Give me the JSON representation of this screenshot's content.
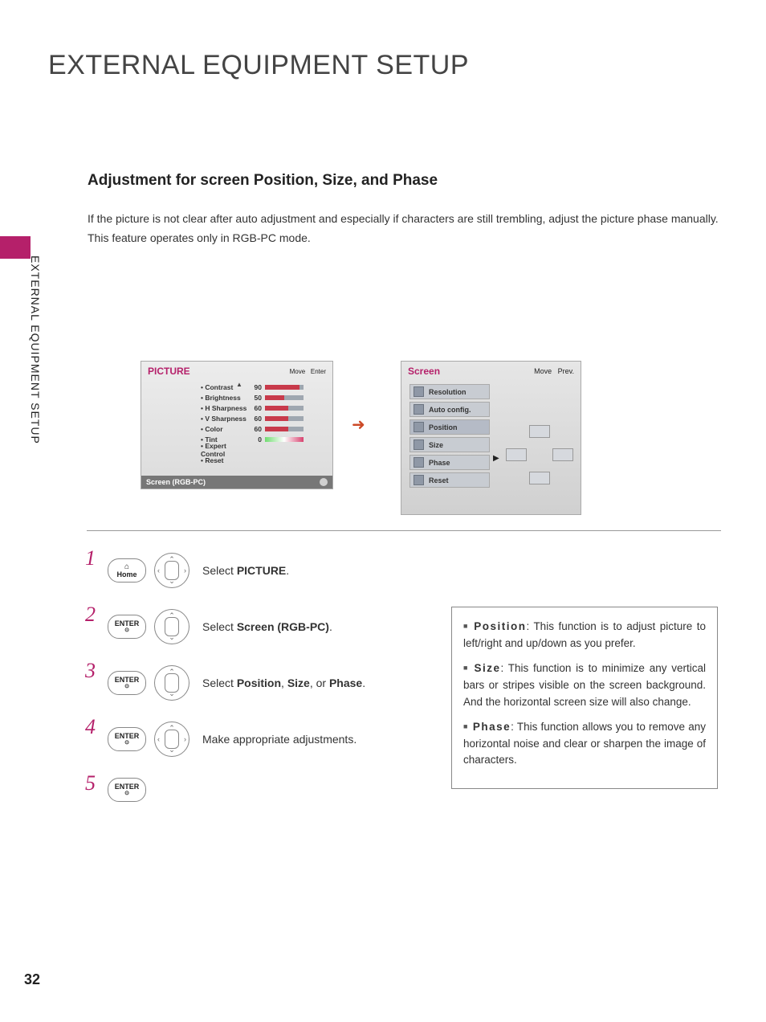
{
  "page_number": "32",
  "side_label": "EXTERNAL EQUIPMENT SETUP",
  "title": "EXTERNAL EQUIPMENT SETUP",
  "subtitle": "Adjustment for screen Position, Size, and Phase",
  "body_p1": "If the picture is not clear after auto adjustment and especially if characters are still trembling, adjust the picture phase manually.",
  "body_p2": "This feature operates only in RGB-PC mode.",
  "picture_menu": {
    "header": "PICTURE",
    "hint_move": "Move",
    "hint_enter": "Enter",
    "rows": [
      {
        "label": "• Contrast",
        "value": "90",
        "fill": 90
      },
      {
        "label": "• Brightness",
        "value": "50",
        "fill": 50
      },
      {
        "label": "• H Sharpness",
        "value": "60",
        "fill": 60
      },
      {
        "label": "• V Sharpness",
        "value": "60",
        "fill": 60
      },
      {
        "label": "• Color",
        "value": "60",
        "fill": 60
      }
    ],
    "tint_label": "• Tint",
    "tint_value": "0",
    "expert": "• Expert Control",
    "reset": "• Reset",
    "selected": "Screen (RGB-PC)"
  },
  "screen_menu": {
    "header": "Screen",
    "hint_move": "Move",
    "hint_prev": "Prev.",
    "options": [
      "Resolution",
      "Auto config.",
      "Position",
      "Size",
      "Phase",
      "Reset"
    ],
    "selected_index": 2
  },
  "steps": [
    {
      "n": "1",
      "btn": "Home",
      "dpad": "full",
      "text_pre": "Select ",
      "text_bold": "PICTURE",
      "text_post": "."
    },
    {
      "n": "2",
      "btn": "ENTER",
      "dpad": "ud",
      "text_pre": "Select ",
      "text_bold": "Screen (RGB-PC)",
      "text_post": "."
    },
    {
      "n": "3",
      "btn": "ENTER",
      "dpad": "ud",
      "text_pre": "Select ",
      "text_bold": "Position",
      "text_mid": ", ",
      "text_bold2": "Size",
      "text_mid2": ", or ",
      "text_bold3": "Phase",
      "text_post": "."
    },
    {
      "n": "4",
      "btn": "ENTER",
      "dpad": "full",
      "text_pre": "Make appropriate adjustments.",
      "text_bold": "",
      "text_post": ""
    },
    {
      "n": "5",
      "btn": "ENTER",
      "dpad": "none",
      "text_pre": "",
      "text_bold": "",
      "text_post": ""
    }
  ],
  "info": {
    "i1_b": "Position",
    "i1": ": This function is to adjust picture to left/right and up/down as you prefer.",
    "i2_b": "Size",
    "i2": ": This function is to minimize any vertical bars or stripes visible on the screen background. And the horizontal screen size will also change.",
    "i3_b": "Phase",
    "i3": ": This function allows you to remove any horizontal noise and clear or sharpen the image of characters."
  }
}
